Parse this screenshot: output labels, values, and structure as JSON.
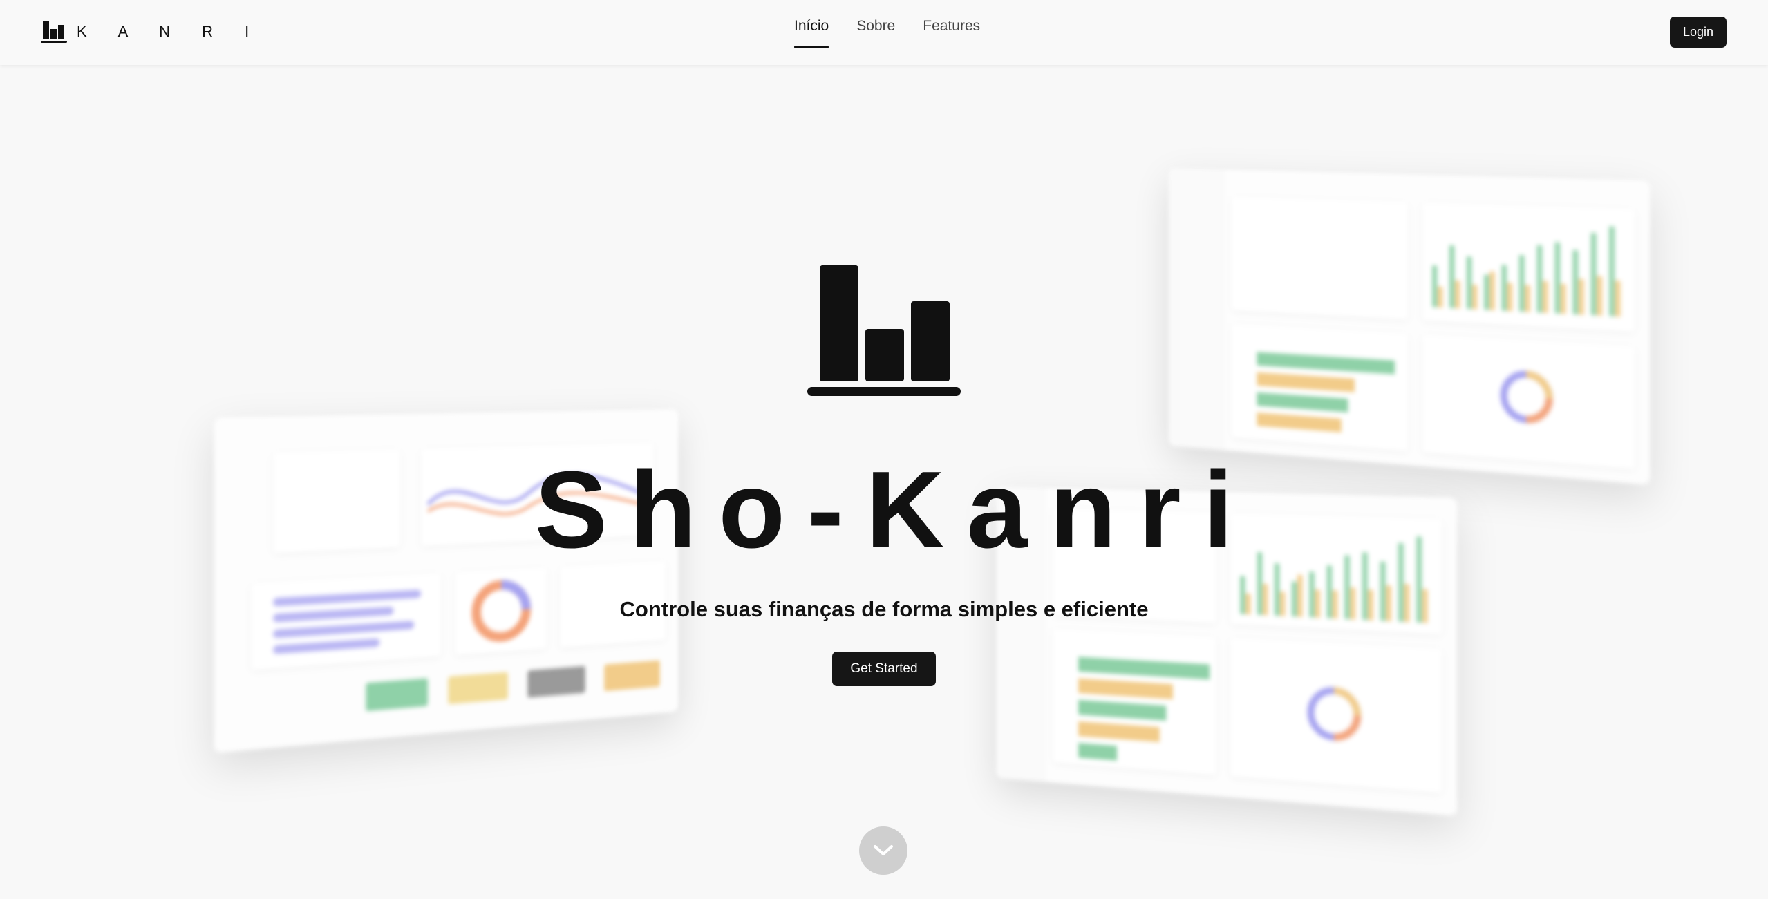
{
  "header": {
    "brand_name": "K A N R I",
    "nav": [
      {
        "label": "Início",
        "active": true
      },
      {
        "label": "Sobre",
        "active": false
      },
      {
        "label": "Features",
        "active": false
      }
    ],
    "login_label": "Login"
  },
  "hero": {
    "title": "Sho-Kanri",
    "subtitle": "Controle suas finanças de forma simples e eficiente",
    "cta_label": "Get Started",
    "logo_icon": "bar-chart-logo-icon",
    "scroll_icon": "chevron-down-icon"
  },
  "colors": {
    "primary": "#161616",
    "background": "#f8f8f8",
    "chart_green": "#8fd1a8",
    "chart_yellow": "#f2cc8a",
    "chart_purple": "#a6a3f0",
    "chart_orange": "#f4a37a"
  }
}
